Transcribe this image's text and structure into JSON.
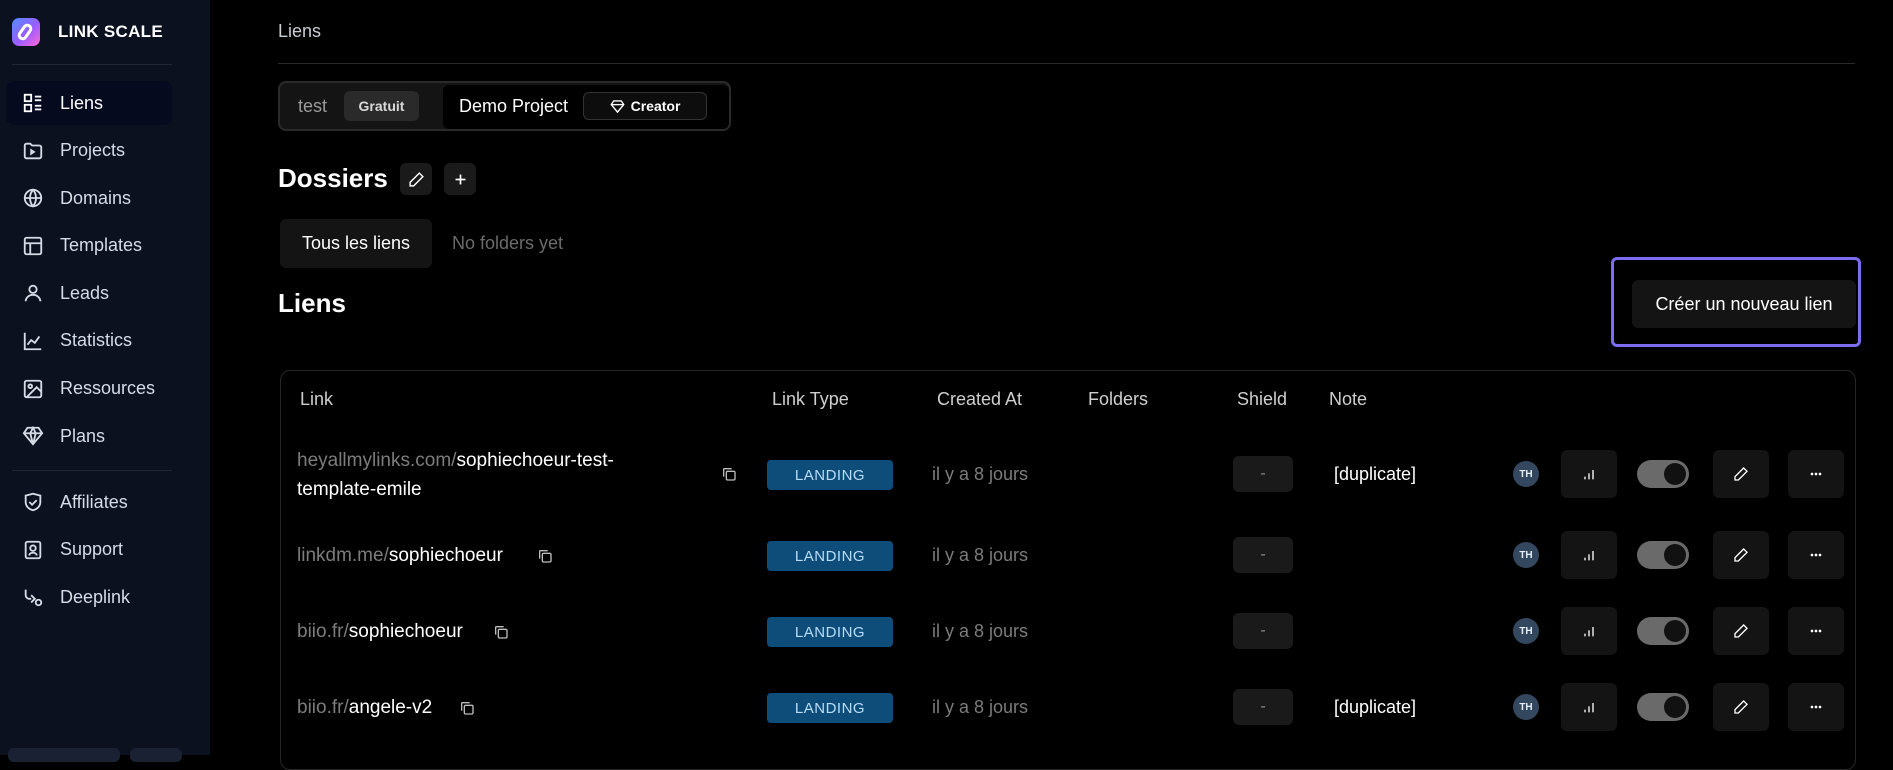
{
  "brand": {
    "name": "LINK SCALE"
  },
  "sidebar": {
    "items": [
      {
        "label": "Liens",
        "icon": "links-list-icon",
        "active": true
      },
      {
        "label": "Projects",
        "icon": "folder-icon"
      },
      {
        "label": "Domains",
        "icon": "globe-icon"
      },
      {
        "label": "Templates",
        "icon": "layout-icon"
      },
      {
        "label": "Leads",
        "icon": "user-icon"
      },
      {
        "label": "Statistics",
        "icon": "chart-icon"
      },
      {
        "label": "Ressources",
        "icon": "image-icon"
      },
      {
        "label": "Plans",
        "icon": "diamond-icon"
      }
    ],
    "bottom_items": [
      {
        "label": "Affiliates",
        "icon": "handshake-icon"
      },
      {
        "label": "Support",
        "icon": "support-icon"
      },
      {
        "label": "Deeplink",
        "icon": "deeplink-icon"
      }
    ]
  },
  "breadcrumb": "Liens",
  "project_switch": {
    "project_a": {
      "name": "test",
      "plan": "Gratuit"
    },
    "project_b": {
      "name": "Demo Project",
      "plan": "Creator"
    }
  },
  "folders": {
    "title": "Dossiers",
    "tab_all": "Tous les liens",
    "empty_text": "No folders yet"
  },
  "links_section": {
    "title": "Liens",
    "create_button": "Créer un nouveau lien"
  },
  "table": {
    "headers": [
      "Link",
      "Link Type",
      "Created At",
      "Folders",
      "Shield",
      "Note"
    ],
    "rows": [
      {
        "domain": "heyallmylinks.com/",
        "path_line1": "sophiechoeur-test-",
        "path_line2": "template-emile",
        "type": "LANDING",
        "created": "il y a 8 jours",
        "shield": "-",
        "note": "[duplicate]",
        "avatar": "TH"
      },
      {
        "domain": "linkdm.me/",
        "path": "sophiechoeur",
        "type": "LANDING",
        "created": "il y a 8 jours",
        "shield": "-",
        "note": "",
        "avatar": "TH"
      },
      {
        "domain": "biio.fr/",
        "path": "sophiechoeur",
        "type": "LANDING",
        "created": "il y a 8 jours",
        "shield": "-",
        "note": "",
        "avatar": "TH"
      },
      {
        "domain": "biio.fr/",
        "path": "angele-v2",
        "type": "LANDING",
        "created": "il y a 8 jours",
        "shield": "-",
        "note": "[duplicate]",
        "avatar": "TH"
      }
    ]
  },
  "colors": {
    "sidebar_bg": "#0c1120",
    "page_bg": "#000000",
    "badge_bg": "#0e4d7a",
    "highlight_border": "#7c6cf0"
  }
}
